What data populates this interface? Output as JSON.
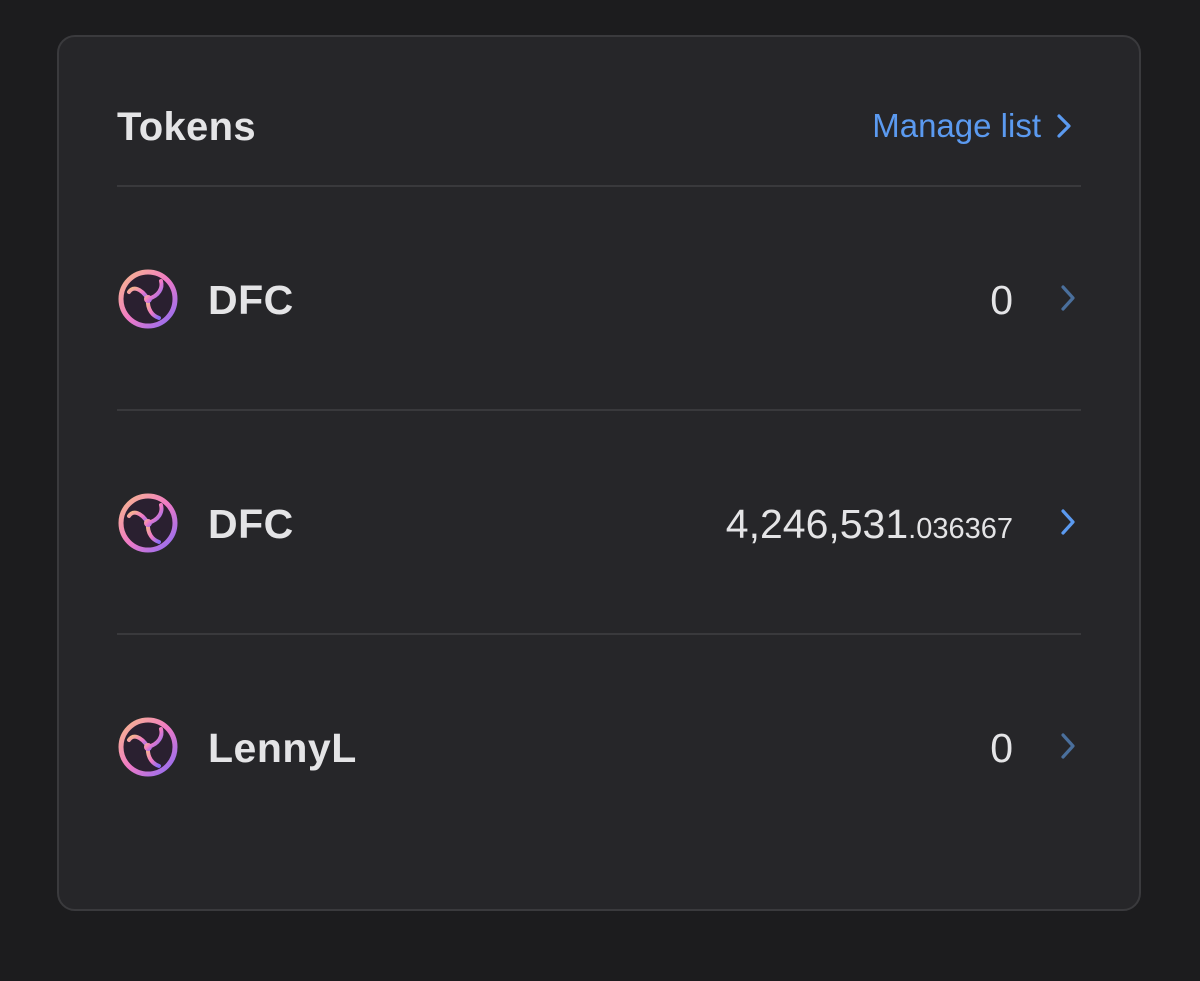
{
  "header": {
    "title": "Tokens",
    "manage_label": "Manage list"
  },
  "colors": {
    "background": "#1c1c1e",
    "card": "#262629",
    "accent": "#5b9af0",
    "text": "#e4e4e6",
    "divider": "#39393c"
  },
  "tokens": [
    {
      "icon": "token-logo-icon",
      "symbol": "DFC",
      "amount_int": "0",
      "amount_dec": "",
      "chevron_color": "#4a6f9c"
    },
    {
      "icon": "token-logo-icon",
      "symbol": "DFC",
      "amount_int": "4,246,531",
      "amount_dec": ".036367",
      "chevron_color": "#5b9af0"
    },
    {
      "icon": "token-logo-icon",
      "symbol": "LennyL",
      "amount_int": "0",
      "amount_dec": "",
      "chevron_color": "#4a6f9c"
    }
  ]
}
